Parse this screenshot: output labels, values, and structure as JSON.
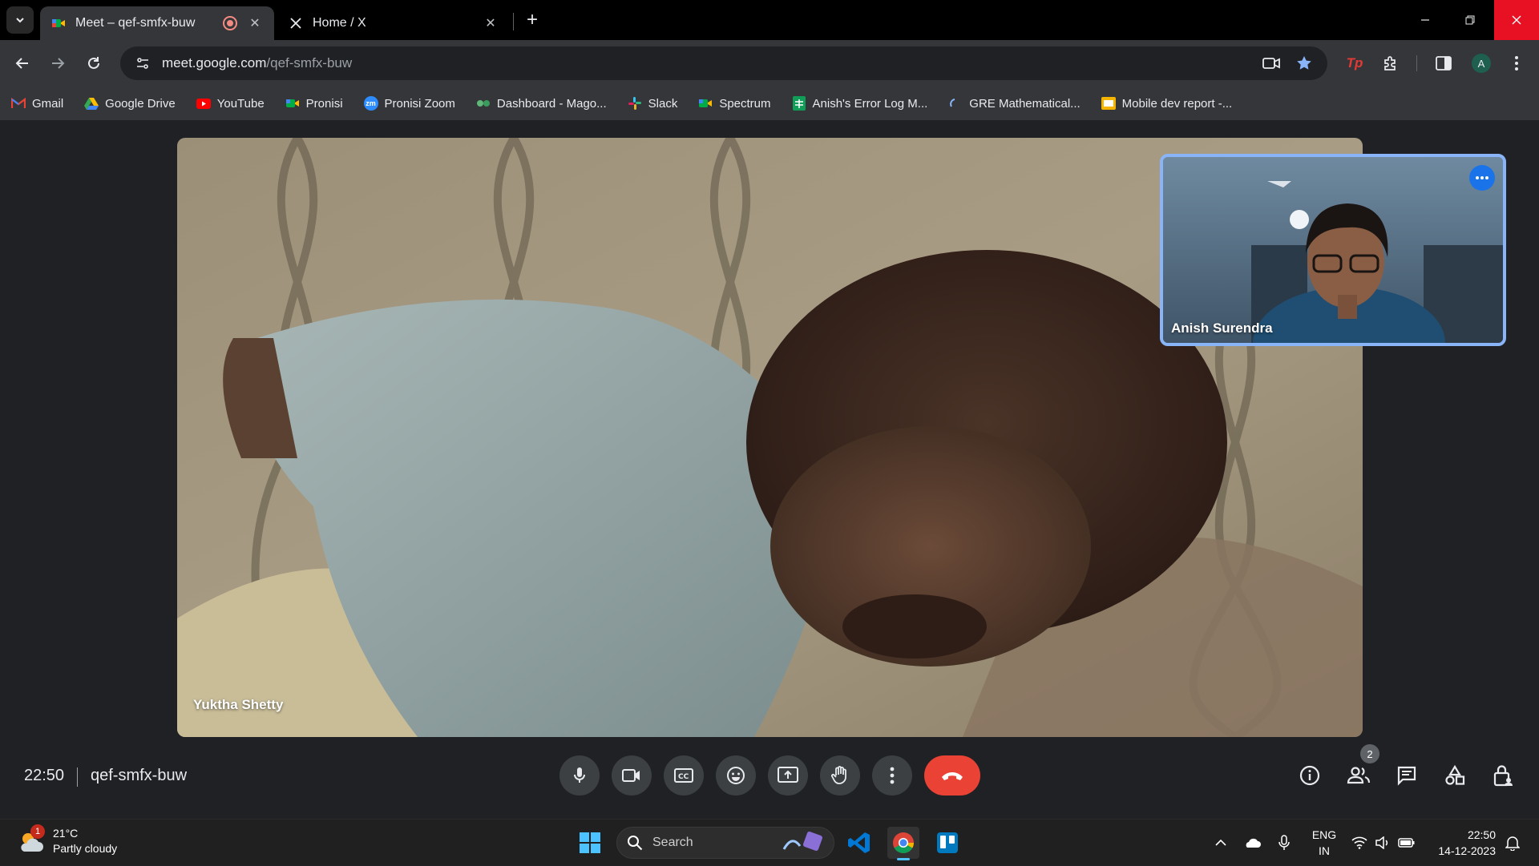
{
  "browser": {
    "tabs": [
      {
        "title": "Meet – qef-smfx-buw",
        "active": true,
        "recording": true
      },
      {
        "title": "Home / X",
        "active": false
      }
    ],
    "url": {
      "host": "meet.google.com",
      "path": "/qef-smfx-buw"
    },
    "profile_initial": "A",
    "bookmarks": [
      {
        "label": "Gmail",
        "icon": "gmail-icon",
        "color": "#ea4335"
      },
      {
        "label": "Google Drive",
        "icon": "drive-icon",
        "color": "#34a853"
      },
      {
        "label": "YouTube",
        "icon": "youtube-icon",
        "color": "#ff0000"
      },
      {
        "label": "Pronisi",
        "icon": "meet-icon",
        "color": "#00897b"
      },
      {
        "label": "Pronisi Zoom",
        "icon": "zoom-icon",
        "color": "#2d8cff"
      },
      {
        "label": "Dashboard - Mago...",
        "icon": "dashboard-icon",
        "color": "#5fb878"
      },
      {
        "label": "Slack",
        "icon": "slack-icon",
        "color": "#e01e5a"
      },
      {
        "label": "Spectrum",
        "icon": "meet-icon",
        "color": "#00897b"
      },
      {
        "label": "Anish's Error Log M...",
        "icon": "sheets-icon",
        "color": "#0f9d58"
      },
      {
        "label": "GRE Mathematical...",
        "icon": "loading-icon",
        "color": "#8ab4f8"
      },
      {
        "label": "Mobile dev report -...",
        "icon": "slides-icon",
        "color": "#f4b400"
      }
    ]
  },
  "meet": {
    "main_participant": "Yuktha Shetty",
    "self_participant": "Anish Surendra",
    "time": "22:50",
    "meeting_code": "qef-smfx-buw",
    "participant_count": "2"
  },
  "taskbar": {
    "weather_temp": "21°C",
    "weather_desc": "Partly cloudy",
    "weather_badge": "1",
    "search_placeholder": "Search",
    "lang_line1": "ENG",
    "lang_line2": "IN",
    "clock_time": "22:50",
    "clock_date": "14-12-2023"
  }
}
